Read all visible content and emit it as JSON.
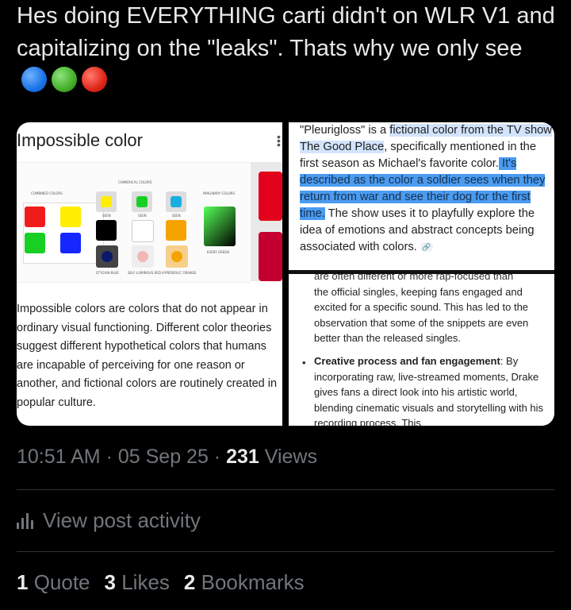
{
  "tweet": {
    "text": "Hes doing EVERYTHING carti didn't on WLR V1 and capitalizing on the \"leaks\". Thats why we only see",
    "emojis": [
      "blue-circle",
      "green-circle",
      "red-circle"
    ]
  },
  "left_panel": {
    "title": "Impossible color",
    "diagram": {
      "heading": "CHIMERICAL COLORS",
      "left_caption": "COMBINED COLORS",
      "right_caption": "IMAGINARY COLORS",
      "footer_labels": [
        "STYGIAN BLUE",
        "SELF-LUMINOUS RED",
        "HYPERBOLIC ORANGE",
        "EVERY GREEN"
      ],
      "swatch_labels": [
        "SEEN",
        "SEEN",
        "SEEN"
      ]
    },
    "description": "Impossible colors are colors that do not appear in ordinary visual functioning. Different color theories suggest different hypothetical colors that humans are incapable of perceiving for one reason or another, and fictional colors are routinely created in popular culture."
  },
  "right_panel": {
    "text_pre": "\"Pleurigloss\" is a ",
    "text_hl1": "fictional color from the TV show The Good Place",
    "text_mid": ", specifically mentioned in the first season as Michael's favorite color.",
    "text_sel": " It's described as the color a soldier sees when they return from war and see their dog for the first time.",
    "text_post": " The show uses it to playfully explore the idea of emotions and abstract concepts being associated with colors.",
    "lower_partial_line": "are often different or more rap-focused than",
    "lower_para": "the official singles, keeping fans engaged and excited for a specific sound. This has led to the observation that some of the snippets are even better than the released singles.",
    "bullet_title": "Creative process and fan engagement",
    "bullet_text": ": By incorporating raw, live-streamed moments, Drake gives fans a direct look into his artistic world, blending cinematic visuals and storytelling with his recording process. This"
  },
  "meta": {
    "time": "10:51 AM",
    "sep": " · ",
    "date": "05 Sep 25",
    "views_count": "231",
    "views_label": " Views"
  },
  "activity": {
    "label": "View post activity"
  },
  "stats": {
    "quotes_count": "1",
    "quotes_label": " Quote",
    "likes_count": "3",
    "likes_label": " Likes",
    "bookmarks_count": "2",
    "bookmarks_label": " Bookmarks"
  },
  "colors": {
    "background": "#000000",
    "text": "#e7e9ea",
    "muted": "#71767b",
    "highlight": "#4b9bf0"
  }
}
